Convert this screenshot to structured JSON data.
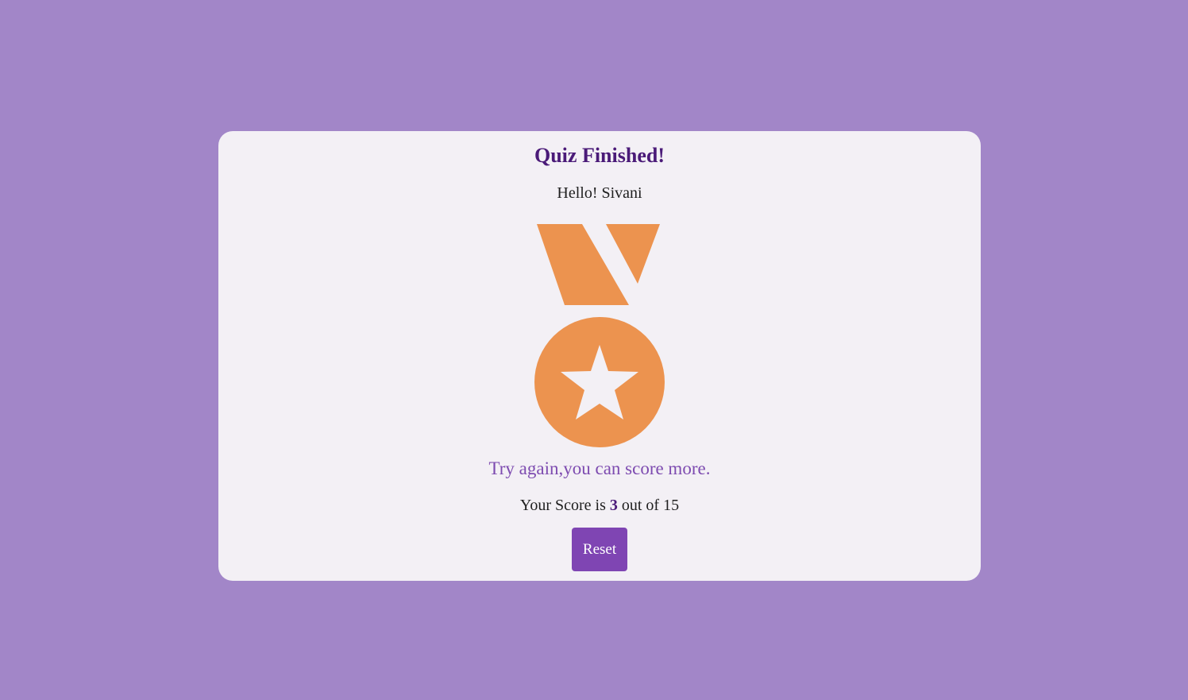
{
  "card": {
    "title": "Quiz Finished!",
    "greeting": "Hello! Sivani",
    "medal_icon": "medal-star-icon",
    "message": "Try again,you can score more.",
    "score": {
      "prefix": "Your Score is",
      "value": "3",
      "middle": "out of",
      "total": "15"
    },
    "reset_label": "Reset"
  },
  "colors": {
    "background": "#a286c8",
    "card": "#f3f0f5",
    "title": "#4a1a78",
    "message": "#7d4bb0",
    "medal": "#ec934f",
    "button": "#7f45b3"
  }
}
